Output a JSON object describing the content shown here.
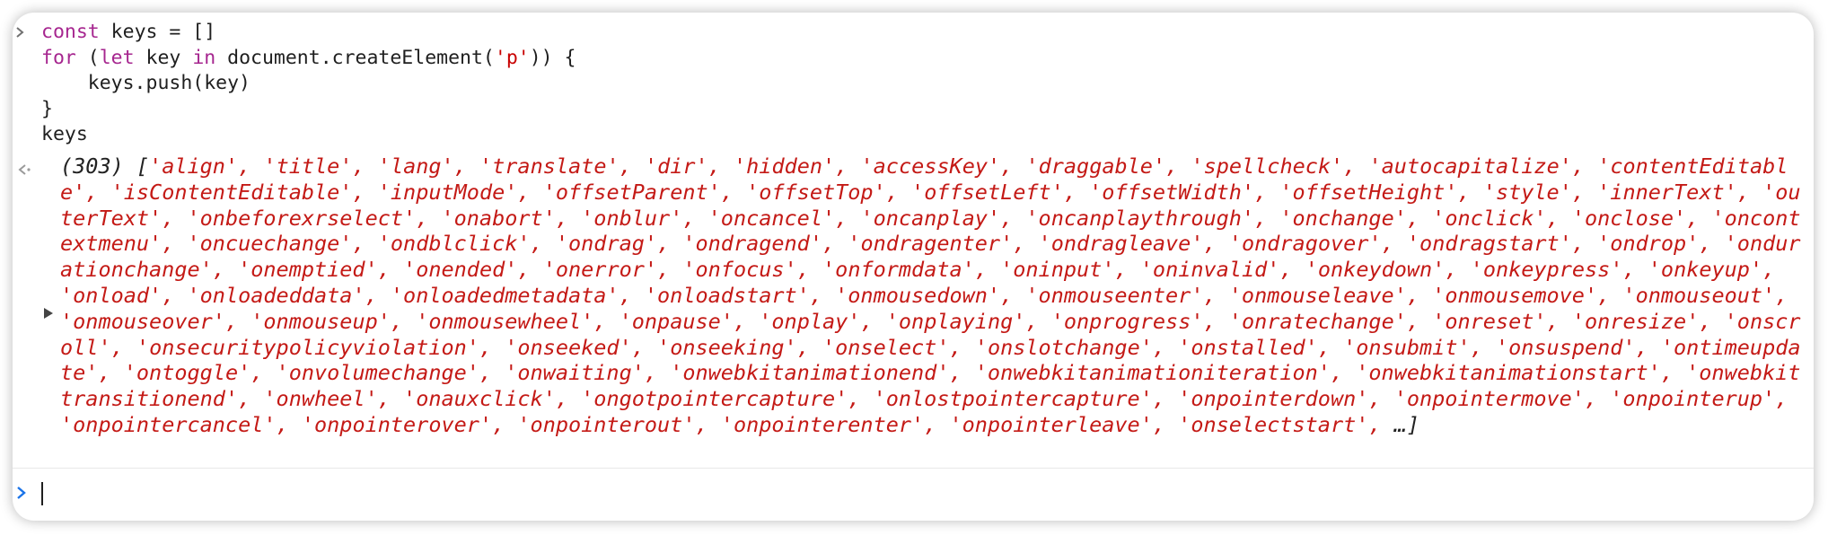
{
  "colors": {
    "keyword": "#a6268f",
    "string": "#c41a16",
    "text": "#1f1f1f",
    "prompt_active": "#1a73e8"
  },
  "input": {
    "prompt_icon": "chevron-right-icon",
    "lines": [
      {
        "tokens": [
          {
            "t": "kw",
            "v": "const"
          },
          {
            "t": "plain",
            "v": " keys = []"
          }
        ]
      },
      {
        "tokens": [
          {
            "t": "kw",
            "v": "for"
          },
          {
            "t": "plain",
            "v": " ("
          },
          {
            "t": "kw",
            "v": "let"
          },
          {
            "t": "plain",
            "v": " key "
          },
          {
            "t": "kw",
            "v": "in"
          },
          {
            "t": "plain",
            "v": " document.createElement("
          },
          {
            "t": "str",
            "v": "'p'"
          },
          {
            "t": "plain",
            "v": ")) {"
          }
        ]
      },
      {
        "tokens": [
          {
            "t": "plain",
            "v": "    keys.push(key)"
          }
        ]
      },
      {
        "tokens": [
          {
            "t": "plain",
            "v": "}"
          }
        ]
      },
      {
        "tokens": [
          {
            "t": "plain",
            "v": "keys"
          }
        ]
      }
    ]
  },
  "result": {
    "marker_icon": "result-arrow-icon",
    "expand_icon": "expand-triangle-icon",
    "count": "(303)",
    "open_bracket": "[",
    "close_bracket": "]",
    "ellipsis": "…",
    "items": [
      "align",
      "title",
      "lang",
      "translate",
      "dir",
      "hidden",
      "accessKey",
      "draggable",
      "spellcheck",
      "autocapitalize",
      "contentEditable",
      "isContentEditable",
      "inputMode",
      "offsetParent",
      "offsetTop",
      "offsetLeft",
      "offsetWidth",
      "offsetHeight",
      "style",
      "innerText",
      "outerText",
      "onbeforexrselect",
      "onabort",
      "onblur",
      "oncancel",
      "oncanplay",
      "oncanplaythrough",
      "onchange",
      "onclick",
      "onclose",
      "oncontextmenu",
      "oncuechange",
      "ondblclick",
      "ondrag",
      "ondragend",
      "ondragenter",
      "ondragleave",
      "ondragover",
      "ondragstart",
      "ondrop",
      "ondurationchange",
      "onemptied",
      "onended",
      "onerror",
      "onfocus",
      "onformdata",
      "oninput",
      "oninvalid",
      "onkeydown",
      "onkeypress",
      "onkeyup",
      "onload",
      "onloadeddata",
      "onloadedmetadata",
      "onloadstart",
      "onmousedown",
      "onmouseenter",
      "onmouseleave",
      "onmousemove",
      "onmouseout",
      "onmouseover",
      "onmouseup",
      "onmousewheel",
      "onpause",
      "onplay",
      "onplaying",
      "onprogress",
      "onratechange",
      "onreset",
      "onresize",
      "onscroll",
      "onsecuritypolicyviolation",
      "onseeked",
      "onseeking",
      "onselect",
      "onslotchange",
      "onstalled",
      "onsubmit",
      "onsuspend",
      "ontimeupdate",
      "ontoggle",
      "onvolumechange",
      "onwaiting",
      "onwebkitanimationend",
      "onwebkitanimationiteration",
      "onwebkitanimationstart",
      "onwebkittransitionend",
      "onwheel",
      "onauxclick",
      "ongotpointercapture",
      "onlostpointercapture",
      "onpointerdown",
      "onpointermove",
      "onpointerup",
      "onpointercancel",
      "onpointerover",
      "onpointerout",
      "onpointerenter",
      "onpointerleave",
      "onselectstart"
    ]
  },
  "console_input": {
    "prompt_icon": "chevron-right-icon",
    "value": ""
  }
}
